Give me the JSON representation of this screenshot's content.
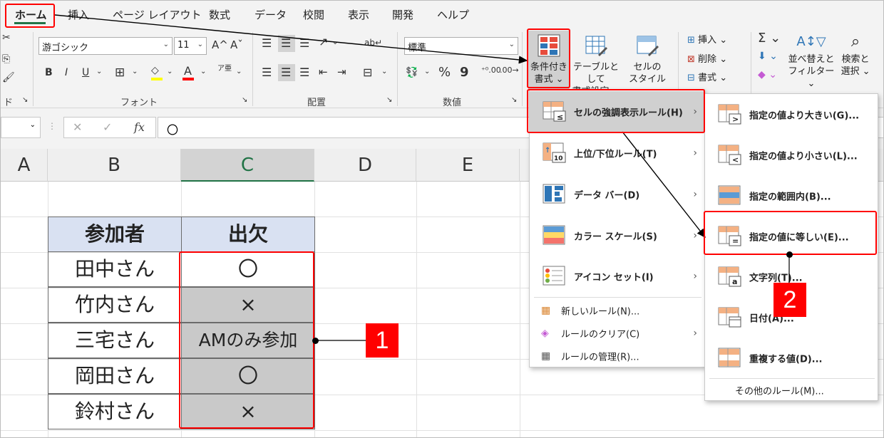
{
  "tabs": [
    "ホーム",
    "挿入",
    "ページ レイアウト",
    "数式",
    "データ",
    "校閲",
    "表示",
    "開発",
    "ヘルプ"
  ],
  "ribbon": {
    "font_name": "游ゴシック",
    "font_size": "11",
    "grow_font": "A^",
    "shrink_font": "Aˇ",
    "bold": "B",
    "italic": "I",
    "underline": "U",
    "phonetic": "ア亜",
    "clipboard_label": "ド",
    "font_group_label": "フォント",
    "align_group_label": "配置",
    "number_format": "標準",
    "percent": "%",
    "comma": "9",
    "number_group_label": "数値",
    "cond_format": [
      "条件付き",
      "書式"
    ],
    "format_as_table": [
      "テーブルとして",
      "書式設定"
    ],
    "cell_styles": [
      "セルの",
      "スタイル"
    ],
    "insert_cmd": "挿入",
    "delete_cmd": "削除",
    "format_cmd": "書式",
    "sort_filter": [
      "並べ替えと",
      "フィルター"
    ],
    "find_select": [
      "検索と",
      "選択"
    ]
  },
  "formula_bar": {
    "fx": "fx",
    "cancel": "✕",
    "confirm": "✓",
    "content": "〇"
  },
  "columns": [
    "A",
    "B",
    "C",
    "D",
    "E"
  ],
  "table": {
    "headers": [
      "参加者",
      "出欠"
    ],
    "rows": [
      [
        "田中さん",
        "〇"
      ],
      [
        "竹内さん",
        "×"
      ],
      [
        "三宅さん",
        "AMのみ参加"
      ],
      [
        "岡田さん",
        "〇"
      ],
      [
        "鈴村さん",
        "×"
      ]
    ]
  },
  "main_menu": {
    "items": [
      {
        "label": "セルの強調表示ルール(H)",
        "has_submenu": true
      },
      {
        "label": "上位/下位ルール(T)",
        "has_submenu": true
      },
      {
        "label": "データ バー(D)",
        "has_submenu": true
      },
      {
        "label": "カラー スケール(S)",
        "has_submenu": true
      },
      {
        "label": "アイコン セット(I)",
        "has_submenu": true
      }
    ],
    "small_items": [
      {
        "label": "新しいルール(N)..."
      },
      {
        "label": "ルールのクリア(C)",
        "has_submenu": true
      },
      {
        "label": "ルールの管理(R)..."
      }
    ]
  },
  "sub_menu": {
    "items": [
      {
        "label": "指定の値より大きい(G)..."
      },
      {
        "label": "指定の値より小さい(L)..."
      },
      {
        "label": "指定の範囲内(B)..."
      },
      {
        "label": "指定の値に等しい(E)..."
      },
      {
        "label": "文字列(T)..."
      },
      {
        "label": "日付(A)..."
      },
      {
        "label": "重複する値(D)..."
      }
    ],
    "more_rules": "その他のルール(M)..."
  },
  "annotations": {
    "badge1": "1",
    "badge2": "2"
  },
  "colors": {
    "accent_green": "#217346",
    "highlight_red": "#ff0000",
    "header_fill": "#d9e1f2",
    "gray_fill": "#c9c9c9"
  }
}
